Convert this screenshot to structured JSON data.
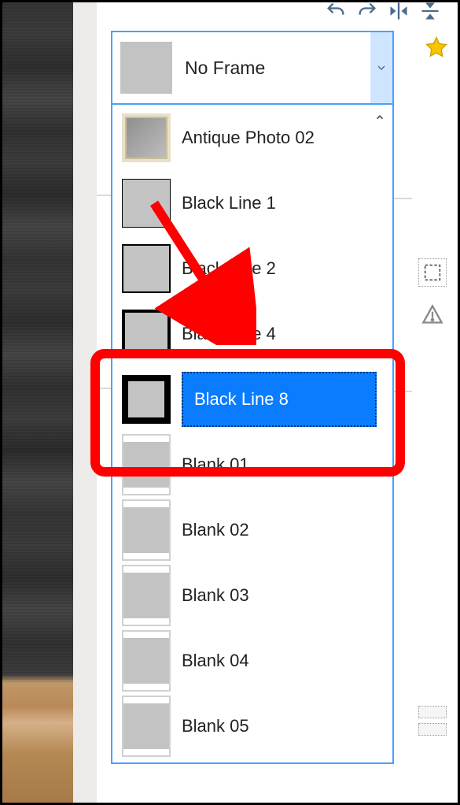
{
  "dropdown": {
    "selected_label": "No Frame",
    "items": [
      {
        "label": "Antique Photo 02",
        "style": "antique"
      },
      {
        "label": "Black Line 1",
        "style": "bl1"
      },
      {
        "label": "Black Line 2",
        "style": "bl2"
      },
      {
        "label": "Black Line 4",
        "style": "bl4"
      },
      {
        "label": "Black Line 8",
        "style": "bl8",
        "selected": true
      },
      {
        "label": "Blank 01",
        "style": "blank"
      },
      {
        "label": "Blank 02",
        "style": "blank"
      },
      {
        "label": "Blank 03",
        "style": "blank"
      },
      {
        "label": "Blank 04",
        "style": "blank"
      },
      {
        "label": "Blank 05",
        "style": "blank"
      }
    ]
  },
  "annotation": {
    "highlight_label": "Black Line 8"
  }
}
